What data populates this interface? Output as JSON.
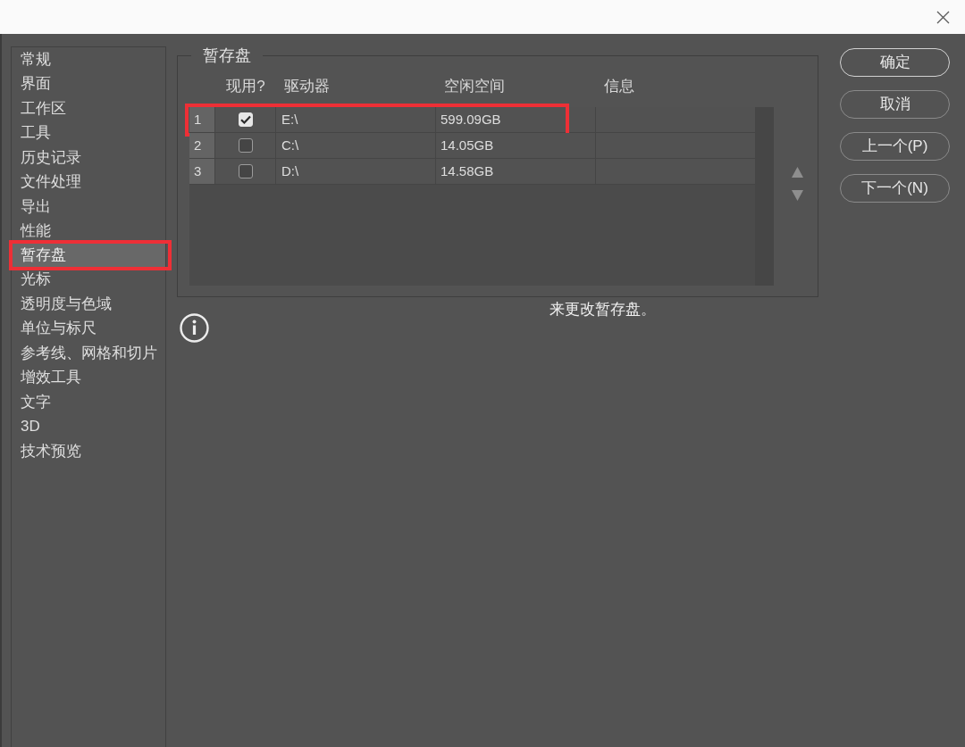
{
  "sidebar": {
    "items": [
      {
        "label": "常规",
        "selected": false,
        "highlighted": false
      },
      {
        "label": "界面",
        "selected": false,
        "highlighted": false
      },
      {
        "label": "工作区",
        "selected": false,
        "highlighted": false
      },
      {
        "label": "工具",
        "selected": false,
        "highlighted": false
      },
      {
        "label": "历史记录",
        "selected": false,
        "highlighted": false
      },
      {
        "label": "文件处理",
        "selected": false,
        "highlighted": false
      },
      {
        "label": "导出",
        "selected": false,
        "highlighted": false
      },
      {
        "label": "性能",
        "selected": false,
        "highlighted": false
      },
      {
        "label": "暂存盘",
        "selected": true,
        "highlighted": true
      },
      {
        "label": "光标",
        "selected": false,
        "highlighted": false
      },
      {
        "label": "透明度与色域",
        "selected": false,
        "highlighted": false
      },
      {
        "label": "单位与标尺",
        "selected": false,
        "highlighted": false
      },
      {
        "label": "参考线、网格和切片",
        "selected": false,
        "highlighted": false
      },
      {
        "label": "增效工具",
        "selected": false,
        "highlighted": false
      },
      {
        "label": "文字",
        "selected": false,
        "highlighted": false
      },
      {
        "label": "3D",
        "selected": false,
        "highlighted": false
      },
      {
        "label": "技术预览",
        "selected": false,
        "highlighted": false
      }
    ]
  },
  "scratch_disks": {
    "title": "暂存盘",
    "columns": [
      "现用?",
      "驱动器",
      "空闲空间",
      "信息"
    ],
    "rows": [
      {
        "number": "1",
        "active": true,
        "drive": "E:\\",
        "free_space": "599.09GB",
        "highlighted": true
      },
      {
        "number": "2",
        "active": false,
        "drive": "C:\\",
        "free_space": "14.05GB",
        "highlighted": false
      },
      {
        "number": "3",
        "active": false,
        "drive": "D:\\",
        "free_space": "14.58GB",
        "highlighted": false
      }
    ]
  },
  "hint": "来更改暂存盘。",
  "buttons": [
    {
      "label": "确定",
      "default": true
    },
    {
      "label": "取消",
      "default": false
    },
    {
      "label": "上一个(P)",
      "default": false
    },
    {
      "label": "下一个(N)",
      "default": false
    }
  ]
}
